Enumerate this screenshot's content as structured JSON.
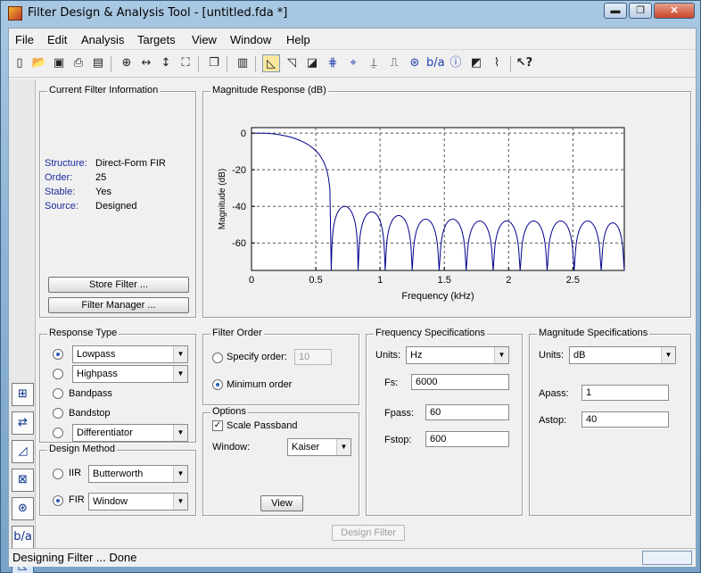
{
  "window": {
    "title": "Filter Design & Analysis Tool -  [untitled.fda *]",
    "controls": [
      "▬",
      "❐",
      "✕"
    ]
  },
  "menu": [
    "File",
    "Edit",
    "Analysis",
    "Targets",
    "View",
    "Window",
    "Help"
  ],
  "toolbar": {
    "icons": [
      "new-icon",
      "open-icon",
      "save-icon",
      "print-icon",
      "print-preview-icon",
      "zoom-in-icon",
      "zoom-x-icon",
      "zoom-y-icon",
      "full-view-icon",
      "new-figure-icon",
      "filter-specs-icon",
      "magnitude-icon",
      "phase-icon",
      "magnitude-phase-icon",
      "group-delay-icon",
      "phase-delay-icon",
      "impulse-icon",
      "step-icon",
      "pole-zero-icon",
      "coefficients-icon",
      "info-icon",
      "magnitude-estimate-icon",
      "noise-psd-icon",
      "whats-this-icon"
    ]
  },
  "current_filter": {
    "title": "Current Filter Information",
    "rows": [
      {
        "label": "Structure:",
        "value": "Direct-Form FIR"
      },
      {
        "label": "Order:",
        "value": "25"
      },
      {
        "label": "Stable:",
        "value": "Yes"
      },
      {
        "label": "Source:",
        "value": "Designed"
      }
    ],
    "store_button": "Store Filter ...",
    "manager_button": "Filter Manager ..."
  },
  "magnitude_panel": {
    "title": "Magnitude Response (dB)"
  },
  "chart_data": {
    "type": "line",
    "title": "",
    "xlabel": "Frequency (kHz)",
    "ylabel": "Magnitude (dB)",
    "xlim": [
      0,
      2.9
    ],
    "ylim": [
      -75,
      3
    ],
    "x_ticks": [
      "0",
      "0.5",
      "1",
      "1.5",
      "2",
      "2.5"
    ],
    "y_ticks": [
      "0",
      "-20",
      "-40",
      "-60"
    ],
    "grid": true,
    "passband_edge_khz": 0.06,
    "stopband_edge_khz": 0.6,
    "stopband_lobe_peaks_db": [
      -40,
      -43,
      -45,
      -47,
      -47,
      -48,
      -48,
      -48,
      -48,
      -48,
      -49
    ],
    "stopband_nulls_khz": [
      0.62,
      0.83,
      1.04,
      1.25,
      1.46,
      1.67,
      1.88,
      2.09,
      2.3,
      2.51,
      2.72,
      2.9
    ]
  },
  "response_type": {
    "title": "Response Type",
    "options": [
      {
        "label": "Lowpass",
        "selected": true,
        "has_select": true
      },
      {
        "label": "Highpass",
        "selected": false,
        "has_select": true
      },
      {
        "label": "Bandpass",
        "selected": false,
        "has_select": false
      },
      {
        "label": "Bandstop",
        "selected": false,
        "has_select": false
      },
      {
        "label": "Differentiator",
        "selected": false,
        "has_select": true
      }
    ]
  },
  "design_method": {
    "title": "Design Method",
    "iir_label": "IIR",
    "iir_value": "Butterworth",
    "fir_label": "FIR",
    "fir_value": "Window",
    "selected": "FIR"
  },
  "filter_order": {
    "title": "Filter Order",
    "specify_label": "Specify order:",
    "specify_value": "10",
    "minimum_label": "Minimum order",
    "selected": "minimum"
  },
  "options": {
    "title": "Options",
    "scale_label": "Scale Passband",
    "scale_checked": true,
    "window_label": "Window:",
    "window_value": "Kaiser",
    "view_button": "View"
  },
  "freq_specs": {
    "title": "Frequency Specifications",
    "units_label": "Units:",
    "units_value": "Hz",
    "fs_label": "Fs:",
    "fs_value": "6000",
    "fpass_label": "Fpass:",
    "fpass_value": "60",
    "fstop_label": "Fstop:",
    "fstop_value": "600"
  },
  "mag_specs": {
    "title": "Magnitude Specifications",
    "units_label": "Units:",
    "units_value": "dB",
    "apass_label": "Apass:",
    "apass_value": "1",
    "astop_label": "Astop:",
    "astop_value": "40"
  },
  "design_button": "Design Filter",
  "status": "Designing Filter ... Done"
}
